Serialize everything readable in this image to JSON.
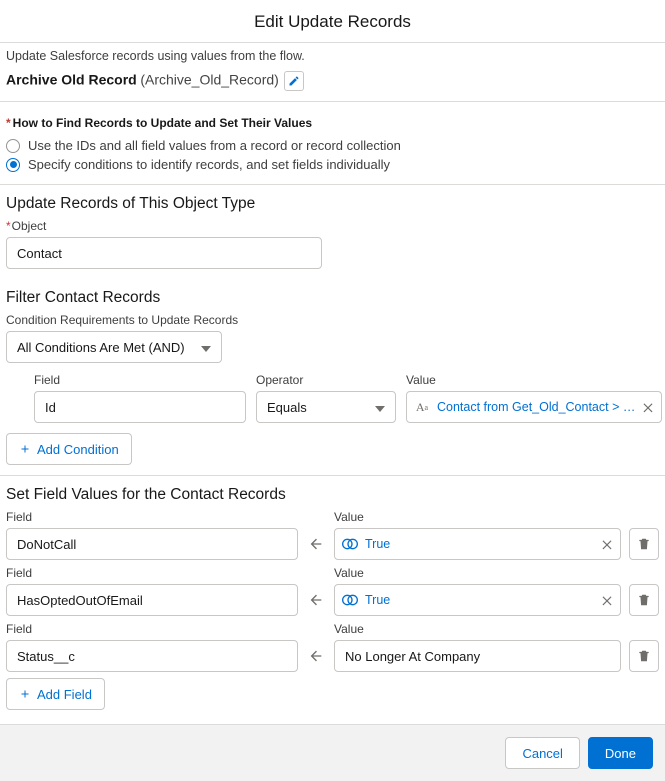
{
  "title": "Edit Update Records",
  "description": "Update Salesforce records using values from the flow.",
  "record": {
    "label": "Archive Old Record",
    "api": "(Archive_Old_Record)"
  },
  "howToFind": {
    "title": "How to Find Records to Update and Set Their Values",
    "opt1": "Use the IDs and all field values from a record or record collection",
    "opt2": "Specify conditions to identify records, and set fields individually"
  },
  "objectSection": {
    "title": "Update Records of This Object Type",
    "label": "Object",
    "value": "Contact"
  },
  "filterSection": {
    "title": "Filter Contact Records",
    "reqLabel": "Condition Requirements to Update Records",
    "reqValue": "All Conditions Are Met (AND)",
    "cols": {
      "field": "Field",
      "operator": "Operator",
      "value": "Value"
    },
    "row": {
      "field": "Id",
      "operator": "Equals",
      "value": "Contact from Get_Old_Contact > …"
    },
    "addCondition": "Add Condition"
  },
  "setSection": {
    "title": "Set Field Values for the Contact Records",
    "fieldLabel": "Field",
    "valueLabel": "Value",
    "rows": [
      {
        "field": "DoNotCall",
        "value": "True",
        "valueType": "bool"
      },
      {
        "field": "HasOptedOutOfEmail",
        "value": "True",
        "valueType": "bool"
      },
      {
        "field": "Status__c",
        "value": "No Longer At Company",
        "valueType": "text"
      }
    ],
    "addField": "Add Field"
  },
  "footer": {
    "cancel": "Cancel",
    "done": "Done"
  }
}
